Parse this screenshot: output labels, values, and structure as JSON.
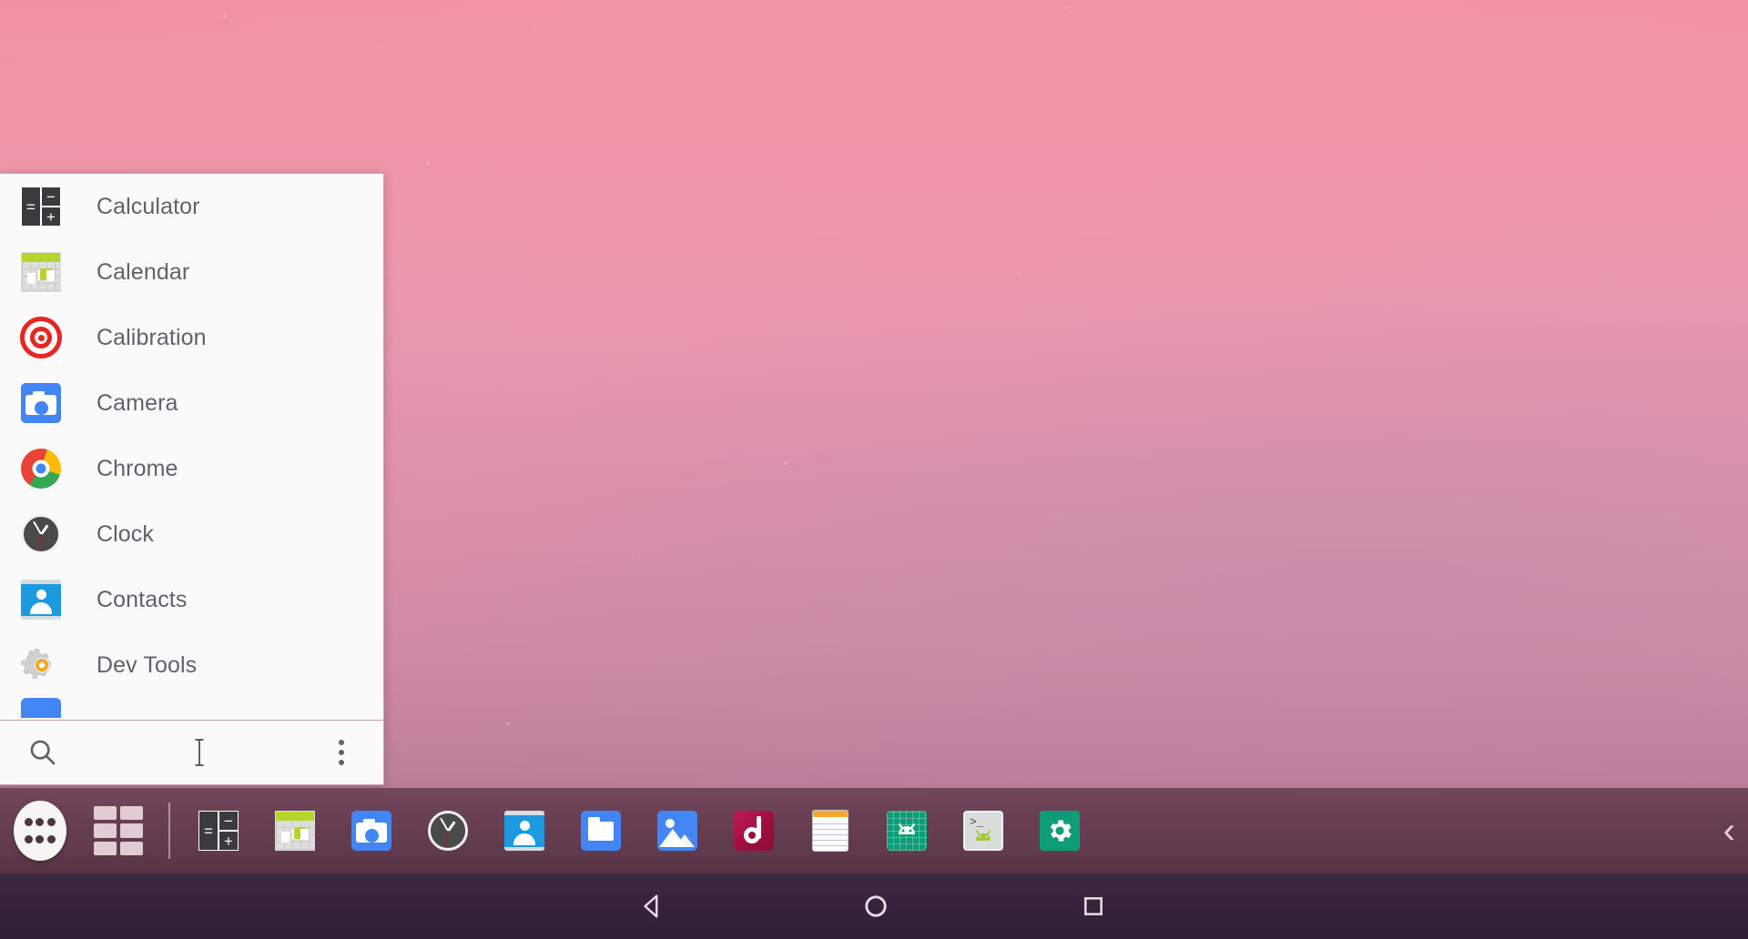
{
  "wallpaper": {
    "description": "pink to purple gradient sunset",
    "top_color": "#f0909f",
    "bottom_color": "#8e5c79"
  },
  "app_popup": {
    "items": [
      {
        "label": "Calculator",
        "icon": "calculator-icon"
      },
      {
        "label": "Calendar",
        "icon": "calendar-icon"
      },
      {
        "label": "Calibration",
        "icon": "target-icon"
      },
      {
        "label": "Camera",
        "icon": "camera-icon"
      },
      {
        "label": "Chrome",
        "icon": "chrome-icon"
      },
      {
        "label": "Clock",
        "icon": "clock-icon"
      },
      {
        "label": "Contacts",
        "icon": "contacts-icon"
      },
      {
        "label": "Dev Tools",
        "icon": "gears-icon"
      },
      {
        "label": "",
        "icon": "blue-app-icon-partial"
      }
    ],
    "search": {
      "value": "",
      "placeholder": "",
      "search_icon": "search-icon",
      "overflow_icon": "more-vertical-icon"
    }
  },
  "taskbar": {
    "background": "#5f3a4c",
    "app_drawer": {
      "name": "all-apps",
      "icon": "six-dot-drawer-icon"
    },
    "workspace_grid": {
      "name": "workspaces",
      "icon": "grid-icon"
    },
    "items": [
      {
        "label": "Calculator",
        "icon": "calculator-icon"
      },
      {
        "label": "Calendar",
        "icon": "calendar-icon"
      },
      {
        "label": "Camera",
        "icon": "camera-icon"
      },
      {
        "label": "Clock",
        "icon": "clock-icon"
      },
      {
        "label": "Contacts",
        "icon": "contacts-icon"
      },
      {
        "label": "Files",
        "icon": "folder-icon"
      },
      {
        "label": "Gallery",
        "icon": "gallery-icon"
      },
      {
        "label": "Music",
        "icon": "music-icon"
      },
      {
        "label": "Notes",
        "icon": "notes-icon"
      },
      {
        "label": "Android",
        "icon": "android-grid-icon"
      },
      {
        "label": "Terminal",
        "icon": "terminal-icon"
      },
      {
        "label": "Settings",
        "icon": "settings-gear-icon"
      }
    ],
    "collapse": {
      "label": "‹",
      "icon": "chevron-left-icon"
    }
  },
  "navbar": {
    "back": {
      "icon": "back-triangle-icon"
    },
    "home": {
      "icon": "home-circle-icon"
    },
    "recent": {
      "icon": "recents-square-icon"
    }
  }
}
